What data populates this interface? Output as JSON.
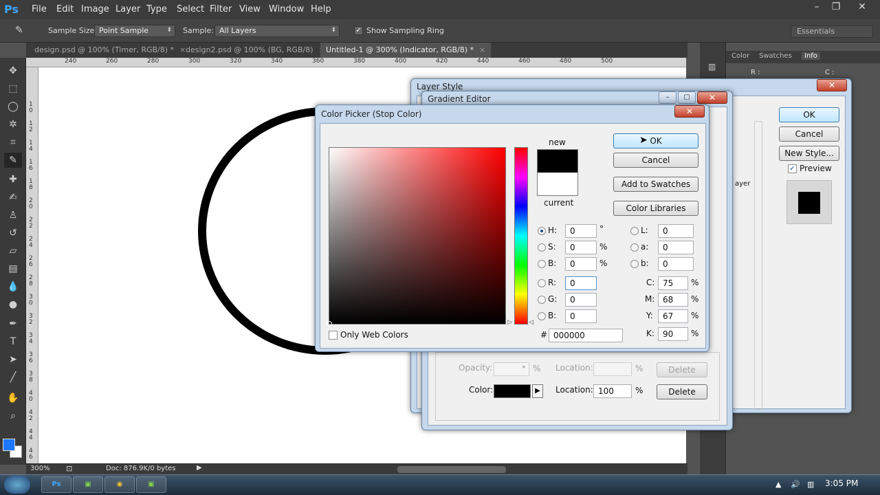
{
  "app": {
    "logo": "Ps",
    "menu": [
      "File",
      "Edit",
      "Image",
      "Layer",
      "Type",
      "Select",
      "Filter",
      "View",
      "Window",
      "Help"
    ],
    "window_controls": {
      "minimize": "–",
      "restore": "❐",
      "close": "✕"
    }
  },
  "options_bar": {
    "sample_size_label": "Sample Size:",
    "sample_size_value": "Point Sample",
    "sample_label": "Sample:",
    "sample_value": "All Layers",
    "show_sampling_ring_label": "Show Sampling Ring",
    "show_sampling_ring_checked": true,
    "workspace": "Essentials"
  },
  "doc_tabs": [
    {
      "label": "design.psd @ 100% (Timer, RGB/8) *",
      "active": false
    },
    {
      "label": "design2.psd @ 100% (BG, RGB/8)",
      "active": false
    },
    {
      "label": "Untitled-1 @ 300% (Indicator, RGB/8) *",
      "active": true
    }
  ],
  "ruler": {
    "top_ticks": [
      "240",
      "260",
      "280",
      "300",
      "320",
      "340",
      "360",
      "380",
      "400",
      "420",
      "440",
      "460",
      "480",
      "500"
    ],
    "left_ticks": [
      "1 0",
      "1 2",
      "1 4",
      "1 6",
      "1 8",
      "2 0",
      "2 2",
      "2 4",
      "2 6",
      "2 8",
      "3 0",
      "3 2",
      "3 4",
      "3 6",
      "3 8",
      "4 0",
      "4 2",
      "4 4",
      "4 6",
      "4 8"
    ]
  },
  "status_bar": {
    "zoom": "300%",
    "doc_info": "Doc: 876.9K/0 bytes"
  },
  "right_panel": {
    "tabs": [
      "Color",
      "Swatches",
      "Info"
    ],
    "active_tab": "Info",
    "info_r": "R :",
    "info_c": "C :"
  },
  "layer_style": {
    "title": "Layer Style",
    "ok_label": "OK",
    "cancel_label": "Cancel",
    "new_style_label": "New Style...",
    "preview_label": "Preview",
    "preview_checked": true,
    "layer_fragment": "ayer"
  },
  "gradient_editor": {
    "title": "Gradient Editor",
    "opacity_label": "Opacity:",
    "opacity_pct": "%",
    "location_label": "Location:",
    "location_pct": "%",
    "delete_label": "Delete",
    "color_label": "Color:",
    "color_location_label": "Location:",
    "color_location_value": "100",
    "color_location_pct": "%",
    "color_delete_label": "Delete",
    "stop_color": "#000000"
  },
  "color_picker": {
    "title": "Color Picker (Stop Color)",
    "ok_label": "OK",
    "cancel_label": "Cancel",
    "add_swatches_label": "Add to Swatches",
    "color_libraries_label": "Color Libraries",
    "new_label": "new",
    "current_label": "current",
    "new_color": "#000000",
    "current_color": "#ffffff",
    "only_web_colors_label": "Only Web Colors",
    "only_web_colors_checked": false,
    "hsb": [
      {
        "label": "H:",
        "value": "0",
        "unit": "°"
      },
      {
        "label": "S:",
        "value": "0",
        "unit": "%"
      },
      {
        "label": "B:",
        "value": "0",
        "unit": "%"
      }
    ],
    "rgb": [
      {
        "label": "R:",
        "value": "0"
      },
      {
        "label": "G:",
        "value": "0"
      },
      {
        "label": "B:",
        "value": "0"
      }
    ],
    "lab": [
      {
        "label": "L:",
        "value": "0"
      },
      {
        "label": "a:",
        "value": "0"
      },
      {
        "label": "b:",
        "value": "0"
      }
    ],
    "cmyk": [
      {
        "label": "C:",
        "value": "75",
        "unit": "%"
      },
      {
        "label": "M:",
        "value": "68",
        "unit": "%"
      },
      {
        "label": "Y:",
        "value": "67",
        "unit": "%"
      },
      {
        "label": "K:",
        "value": "90",
        "unit": "%"
      }
    ],
    "hex_label": "#",
    "hex_value": "000000",
    "selected_field": "H",
    "field_hue": "#ff0000"
  },
  "taskbar": {
    "apps": [
      "Ps",
      "▣",
      "◉",
      "▣"
    ],
    "clock": "3:05 PM"
  }
}
